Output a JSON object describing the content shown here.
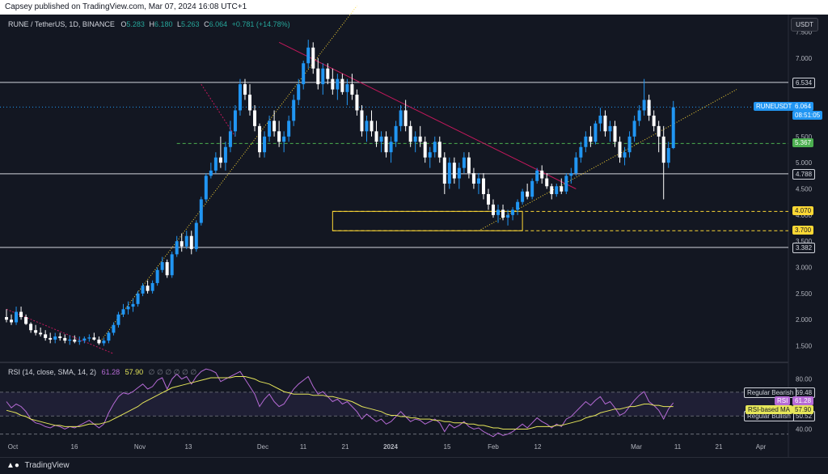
{
  "header": {
    "publisher_line": "Capsey published on TradingView.com, Mar 07, 2024 16:08 UTC+1"
  },
  "legend": {
    "symbol": "RUNE / TetherUS, 1D, BINANCE",
    "open_label": "O",
    "open": "5.283",
    "high_label": "H",
    "high": "6.180",
    "low_label": "L",
    "low": "5.263",
    "close_label": "C",
    "close": "6.064",
    "change": "+0.781 (+14.78%)"
  },
  "currency_button": "USDT",
  "rsi_legend": {
    "label": "RSI (14, close, SMA, 14, 2)",
    "rsi": "61.28",
    "ma": "57.90",
    "hidden_marks": "∅ ∅ ∅ ∅ ∅ ∅"
  },
  "footer": {
    "brand": "TradingView"
  },
  "colors": {
    "background": "#131722",
    "up": "#2196f3",
    "down": "#ffffff",
    "rsi": "#b66bd6",
    "rsi_ma": "#e6e65a",
    "resistance_line": "#c2185b",
    "support_line": "#fdd835"
  },
  "chart_data": [
    {
      "type": "candlestick",
      "title": "RUNE / TetherUS, 1D, BINANCE",
      "y_ticks": [
        "7.500",
        "7.000",
        "6.500",
        "6.000",
        "5.500",
        "5.000",
        "4.500",
        "4.000",
        "3.500",
        "3.000",
        "2.500",
        "2.000",
        "1.500"
      ],
      "ylim": [
        1.2,
        7.8
      ],
      "x_ticks": [
        "Oct",
        "16",
        "Nov",
        "13",
        "Dec",
        "11",
        "21",
        "2024",
        "15",
        "Feb",
        "12",
        "Mar",
        "11",
        "21",
        "Apr"
      ],
      "price_labels": [
        {
          "value": 6.534,
          "label": "6.534",
          "kind": "horizontal-line"
        },
        {
          "value": 6.064,
          "label": "6.064",
          "kind": "last-price",
          "symbol": "RUNEUSDT",
          "countdown": "08:51:05"
        },
        {
          "value": 5.367,
          "label": "5.367",
          "kind": "dashed-green"
        },
        {
          "value": 4.788,
          "label": "4.788",
          "kind": "horizontal-line"
        },
        {
          "value": 4.07,
          "label": "4.070",
          "kind": "dashed-yellow"
        },
        {
          "value": 3.7,
          "label": "3.700",
          "kind": "dashed-yellow"
        },
        {
          "value": 3.382,
          "label": "3.382",
          "kind": "horizontal-line"
        }
      ],
      "ohlc": [
        [
          2.05,
          2.2,
          1.95,
          2.0
        ],
        [
          2.0,
          2.1,
          1.9,
          1.95
        ],
        [
          1.95,
          2.25,
          1.9,
          2.15
        ],
        [
          2.15,
          2.25,
          2.0,
          2.05
        ],
        [
          2.05,
          2.1,
          1.9,
          1.92
        ],
        [
          1.92,
          1.95,
          1.75,
          1.8
        ],
        [
          1.8,
          1.9,
          1.7,
          1.75
        ],
        [
          1.75,
          1.85,
          1.68,
          1.72
        ],
        [
          1.72,
          1.8,
          1.6,
          1.65
        ],
        [
          1.65,
          1.75,
          1.55,
          1.62
        ],
        [
          1.62,
          1.75,
          1.55,
          1.68
        ],
        [
          1.68,
          1.75,
          1.6,
          1.65
        ],
        [
          1.65,
          1.72,
          1.55,
          1.6
        ],
        [
          1.6,
          1.7,
          1.52,
          1.62
        ],
        [
          1.62,
          1.7,
          1.55,
          1.58
        ],
        [
          1.58,
          1.68,
          1.52,
          1.6
        ],
        [
          1.6,
          1.68,
          1.55,
          1.64
        ],
        [
          1.64,
          1.72,
          1.58,
          1.66
        ],
        [
          1.66,
          1.75,
          1.6,
          1.62
        ],
        [
          1.62,
          1.68,
          1.52,
          1.55
        ],
        [
          1.55,
          1.65,
          1.5,
          1.6
        ],
        [
          1.6,
          1.78,
          1.55,
          1.75
        ],
        [
          1.75,
          1.95,
          1.7,
          1.9
        ],
        [
          1.9,
          2.15,
          1.85,
          2.1
        ],
        [
          2.1,
          2.3,
          2.05,
          2.2
        ],
        [
          2.2,
          2.35,
          2.1,
          2.25
        ],
        [
          2.25,
          2.4,
          2.15,
          2.3
        ],
        [
          2.3,
          2.55,
          2.25,
          2.5
        ],
        [
          2.5,
          2.7,
          2.45,
          2.65
        ],
        [
          2.65,
          2.75,
          2.5,
          2.55
        ],
        [
          2.55,
          2.75,
          2.5,
          2.7
        ],
        [
          2.7,
          3.0,
          2.65,
          2.95
        ],
        [
          2.95,
          3.2,
          2.9,
          3.1
        ],
        [
          3.1,
          3.15,
          2.8,
          2.85
        ],
        [
          2.85,
          3.3,
          2.8,
          3.25
        ],
        [
          3.25,
          3.6,
          3.2,
          3.5
        ],
        [
          3.5,
          3.65,
          3.3,
          3.4
        ],
        [
          3.4,
          3.7,
          3.35,
          3.6
        ],
        [
          3.6,
          3.7,
          3.25,
          3.35
        ],
        [
          3.35,
          3.9,
          3.3,
          3.85
        ],
        [
          3.85,
          4.35,
          3.8,
          4.3
        ],
        [
          4.3,
          4.8,
          4.25,
          4.75
        ],
        [
          4.75,
          5.0,
          4.7,
          4.85
        ],
        [
          4.85,
          5.2,
          4.8,
          5.1
        ],
        [
          5.1,
          5.5,
          4.9,
          5.0
        ],
        [
          5.0,
          5.4,
          4.85,
          5.3
        ],
        [
          5.3,
          5.8,
          5.2,
          5.6
        ],
        [
          5.6,
          6.1,
          5.5,
          6.0
        ],
        [
          6.0,
          6.6,
          5.9,
          6.5
        ],
        [
          6.5,
          6.6,
          6.2,
          6.3
        ],
        [
          6.3,
          6.5,
          5.9,
          6.0
        ],
        [
          6.0,
          6.1,
          5.6,
          5.7
        ],
        [
          5.7,
          5.75,
          5.1,
          5.2
        ],
        [
          5.2,
          5.6,
          5.1,
          5.5
        ],
        [
          5.5,
          5.9,
          5.4,
          5.8
        ],
        [
          5.8,
          6.0,
          5.5,
          5.6
        ],
        [
          5.6,
          5.8,
          5.3,
          5.4
        ],
        [
          5.4,
          5.6,
          5.2,
          5.5
        ],
        [
          5.5,
          5.9,
          5.4,
          5.8
        ],
        [
          5.8,
          6.3,
          5.7,
          6.2
        ],
        [
          6.2,
          6.6,
          6.1,
          6.5
        ],
        [
          6.5,
          6.95,
          6.4,
          6.9
        ],
        [
          6.9,
          7.35,
          6.8,
          7.2
        ],
        [
          7.2,
          7.3,
          6.7,
          6.8
        ],
        [
          6.8,
          7.0,
          6.4,
          6.5
        ],
        [
          6.5,
          6.9,
          6.3,
          6.8
        ],
        [
          6.8,
          6.9,
          6.5,
          6.6
        ],
        [
          6.6,
          6.8,
          6.3,
          6.4
        ],
        [
          6.4,
          6.7,
          6.2,
          6.6
        ],
        [
          6.6,
          6.7,
          6.3,
          6.35
        ],
        [
          6.35,
          6.6,
          6.1,
          6.5
        ],
        [
          6.5,
          6.7,
          6.2,
          6.3
        ],
        [
          6.3,
          6.4,
          5.9,
          6.0
        ],
        [
          6.0,
          6.1,
          5.5,
          5.6
        ],
        [
          5.6,
          5.9,
          5.4,
          5.8
        ],
        [
          5.8,
          6.0,
          5.5,
          5.6
        ],
        [
          5.6,
          5.8,
          5.3,
          5.4
        ],
        [
          5.4,
          5.6,
          5.2,
          5.5
        ],
        [
          5.5,
          5.6,
          5.1,
          5.2
        ],
        [
          5.2,
          5.5,
          5.0,
          5.4
        ],
        [
          5.4,
          5.8,
          5.3,
          5.7
        ],
        [
          5.7,
          6.1,
          5.6,
          6.0
        ],
        [
          6.0,
          6.2,
          5.6,
          5.7
        ],
        [
          5.7,
          5.8,
          5.3,
          5.4
        ],
        [
          5.4,
          5.6,
          5.2,
          5.5
        ],
        [
          5.5,
          5.7,
          5.3,
          5.4
        ],
        [
          5.4,
          5.5,
          5.0,
          5.1
        ],
        [
          5.1,
          5.3,
          4.9,
          5.2
        ],
        [
          5.2,
          5.5,
          5.1,
          5.4
        ],
        [
          5.4,
          5.5,
          5.0,
          5.1
        ],
        [
          5.1,
          5.2,
          4.4,
          4.6
        ],
        [
          4.6,
          5.1,
          4.5,
          5.0
        ],
        [
          5.0,
          5.1,
          4.6,
          4.7
        ],
        [
          4.7,
          5.0,
          4.5,
          4.9
        ],
        [
          4.9,
          5.2,
          4.8,
          5.1
        ],
        [
          5.1,
          5.2,
          4.7,
          4.8
        ],
        [
          4.8,
          4.9,
          4.5,
          4.6
        ],
        [
          4.6,
          4.8,
          4.4,
          4.7
        ],
        [
          4.7,
          4.8,
          4.3,
          4.4
        ],
        [
          4.4,
          4.5,
          4.1,
          4.2
        ],
        [
          4.2,
          4.3,
          3.95,
          4.0
        ],
        [
          4.0,
          4.2,
          3.85,
          4.1
        ],
        [
          4.1,
          4.2,
          3.9,
          3.95
        ],
        [
          3.95,
          4.1,
          3.8,
          4.0
        ],
        [
          4.0,
          4.15,
          3.9,
          4.1
        ],
        [
          4.1,
          4.3,
          4.0,
          4.25
        ],
        [
          4.25,
          4.5,
          4.2,
          4.45
        ],
        [
          4.45,
          4.6,
          4.3,
          4.35
        ],
        [
          4.35,
          4.7,
          4.3,
          4.65
        ],
        [
          4.65,
          4.9,
          4.6,
          4.85
        ],
        [
          4.85,
          4.95,
          4.6,
          4.7
        ],
        [
          4.7,
          4.8,
          4.5,
          4.55
        ],
        [
          4.55,
          4.6,
          4.3,
          4.4
        ],
        [
          4.4,
          4.6,
          4.35,
          4.55
        ],
        [
          4.55,
          4.7,
          4.4,
          4.45
        ],
        [
          4.45,
          4.8,
          4.4,
          4.75
        ],
        [
          4.75,
          4.9,
          4.6,
          4.8
        ],
        [
          4.8,
          5.2,
          4.75,
          5.1
        ],
        [
          5.1,
          5.4,
          5.0,
          5.3
        ],
        [
          5.3,
          5.6,
          5.2,
          5.5
        ],
        [
          5.5,
          5.7,
          5.3,
          5.4
        ],
        [
          5.4,
          5.8,
          5.35,
          5.75
        ],
        [
          5.75,
          6.05,
          5.6,
          5.9
        ],
        [
          5.9,
          6.0,
          5.5,
          5.6
        ],
        [
          5.6,
          5.8,
          5.4,
          5.7
        ],
        [
          5.7,
          5.8,
          5.3,
          5.4
        ],
        [
          5.4,
          5.5,
          5.0,
          5.1
        ],
        [
          5.1,
          5.3,
          4.95,
          5.2
        ],
        [
          5.2,
          5.6,
          5.1,
          5.5
        ],
        [
          5.5,
          5.9,
          5.4,
          5.8
        ],
        [
          5.8,
          6.1,
          5.7,
          6.0
        ],
        [
          6.0,
          6.6,
          5.9,
          6.2
        ],
        [
          6.2,
          6.3,
          5.8,
          5.9
        ],
        [
          5.9,
          6.0,
          5.6,
          5.7
        ],
        [
          5.7,
          5.8,
          5.2,
          5.5
        ],
        [
          5.5,
          5.7,
          4.3,
          5.0
        ],
        [
          5.0,
          5.4,
          4.9,
          5.28
        ],
        [
          5.28,
          6.18,
          5.26,
          6.06
        ]
      ]
    },
    {
      "type": "line",
      "title": "RSI (14, close, SMA, 14, 2)",
      "y_ticks": [
        "80.00",
        "60.00",
        "40.00"
      ],
      "ylim": [
        30,
        92
      ],
      "hlines": [
        {
          "value": 69.48,
          "label": "69.48",
          "name": "Regular Bearish"
        },
        {
          "value": 50.52,
          "label": "50.52",
          "name": "Regular Bullish"
        }
      ],
      "last_values": [
        {
          "name": "RSI",
          "label": "61.28",
          "value": 61.28
        },
        {
          "name": "RSI-based MA",
          "label": "57.90",
          "value": 57.9
        }
      ],
      "series": [
        {
          "name": "RSI",
          "values": [
            62,
            57,
            60,
            58,
            54,
            48,
            45,
            44,
            42,
            41,
            43,
            42,
            40,
            42,
            41,
            43,
            45,
            47,
            44,
            41,
            44,
            53,
            60,
            66,
            69,
            68,
            70,
            73,
            76,
            72,
            74,
            79,
            81,
            72,
            80,
            84,
            80,
            82,
            76,
            82,
            86,
            88,
            87,
            85,
            78,
            80,
            82,
            84,
            86,
            80,
            74,
            68,
            58,
            64,
            68,
            62,
            58,
            60,
            66,
            72,
            76,
            79,
            82,
            74,
            68,
            70,
            66,
            62,
            64,
            60,
            62,
            58,
            54,
            48,
            52,
            49,
            46,
            48,
            44,
            46,
            50,
            54,
            50,
            46,
            48,
            47,
            44,
            46,
            48,
            45,
            38,
            44,
            41,
            43,
            46,
            42,
            40,
            41,
            38,
            36,
            34,
            37,
            35,
            36,
            38,
            41,
            44,
            41,
            45,
            49,
            46,
            44,
            41,
            44,
            42,
            48,
            50,
            54,
            58,
            62,
            59,
            63,
            66,
            60,
            62,
            57,
            51,
            53,
            58,
            63,
            67,
            70,
            62,
            59,
            55,
            48,
            56,
            61
          ]
        },
        {
          "name": "RSI-based MA",
          "values": [
            55,
            54,
            53,
            51,
            50,
            48,
            47,
            46,
            45,
            44,
            43,
            43,
            42,
            42,
            42,
            42,
            43,
            44,
            44,
            44,
            45,
            46,
            48,
            50,
            52,
            54,
            56,
            58,
            61,
            63,
            65,
            67,
            69,
            71,
            73,
            74,
            75,
            76,
            77,
            78,
            79,
            80,
            81,
            81,
            81,
            81,
            81,
            82,
            82,
            82,
            81,
            80,
            78,
            77,
            76,
            74,
            72,
            70,
            69,
            68,
            68,
            68,
            68,
            67,
            67,
            67,
            66,
            66,
            65,
            64,
            63,
            62,
            60,
            58,
            57,
            56,
            55,
            54,
            52,
            51,
            51,
            50,
            50,
            49,
            49,
            48,
            48,
            48,
            47,
            47,
            46,
            46,
            45,
            45,
            45,
            44,
            44,
            43,
            43,
            42,
            41,
            41,
            40,
            40,
            40,
            40,
            40,
            40,
            41,
            42,
            42,
            42,
            42,
            43,
            43,
            44,
            45,
            46,
            47,
            49,
            50,
            51,
            53,
            54,
            55,
            56,
            56,
            57,
            58,
            58,
            59,
            60,
            60,
            59,
            59,
            58,
            58,
            58
          ]
        }
      ]
    }
  ]
}
